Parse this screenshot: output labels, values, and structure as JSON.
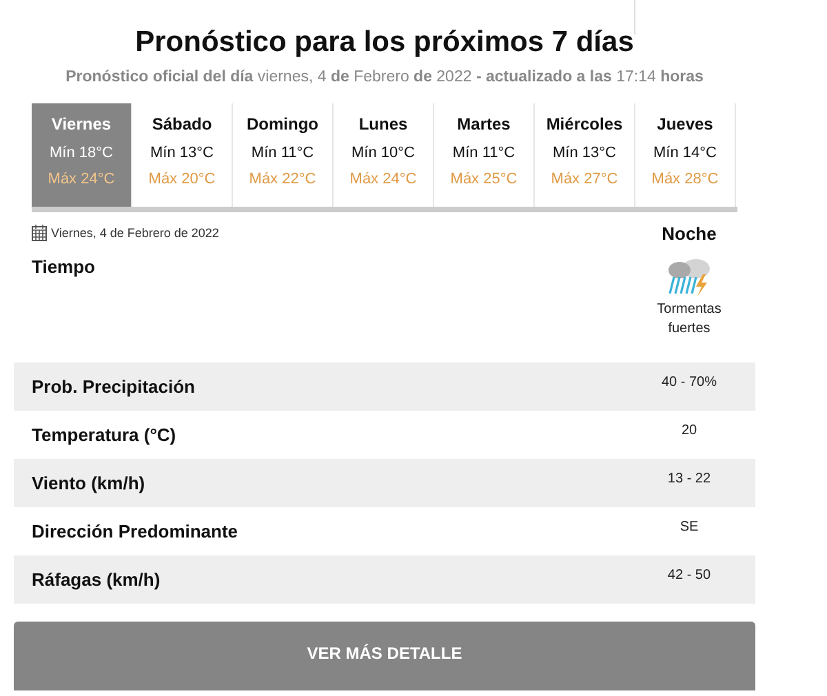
{
  "title": "Pronóstico para los próximos 7 días",
  "subtitle": "**Pronóstico oficial del día** viernes, 4 **de** Febrero **de** 2022 **- actualizado a las** 17:14 **horas**",
  "days": [
    {
      "name": "Viernes",
      "min": "Mín 18°C",
      "max": "Máx 24°C",
      "selected": true
    },
    {
      "name": "Sábado",
      "min": "Mín 13°C",
      "max": "Máx 20°C",
      "selected": false
    },
    {
      "name": "Domingo",
      "min": "Mín 11°C",
      "max": "Máx 22°C",
      "selected": false
    },
    {
      "name": "Lunes",
      "min": "Mín 10°C",
      "max": "Máx 24°C",
      "selected": false
    },
    {
      "name": "Martes",
      "min": "Mín 11°C",
      "max": "Máx 25°C",
      "selected": false
    },
    {
      "name": "Miércoles",
      "min": "Mín 13°C",
      "max": "Máx 27°C",
      "selected": false
    },
    {
      "name": "Jueves",
      "min": "Mín 14°C",
      "max": "Máx 28°C",
      "selected": false
    }
  ],
  "date": "Viernes, 4 de Febrero de 2022",
  "period": "Noche",
  "weather": {
    "label": "Tiempo",
    "description": "Tormentas fuertes"
  },
  "rows": [
    {
      "label": "Prob. Precipitación",
      "value": "40 - 70%"
    },
    {
      "label": "Temperatura (°C)",
      "value": "20"
    },
    {
      "label": "Viento (km/h)",
      "value": "13 - 22"
    },
    {
      "label": "Dirección Predominante",
      "value": "SE"
    },
    {
      "label": "Ráfagas (km/h)",
      "value": "42 - 50"
    }
  ],
  "button": "VER MÁS DETALLE"
}
